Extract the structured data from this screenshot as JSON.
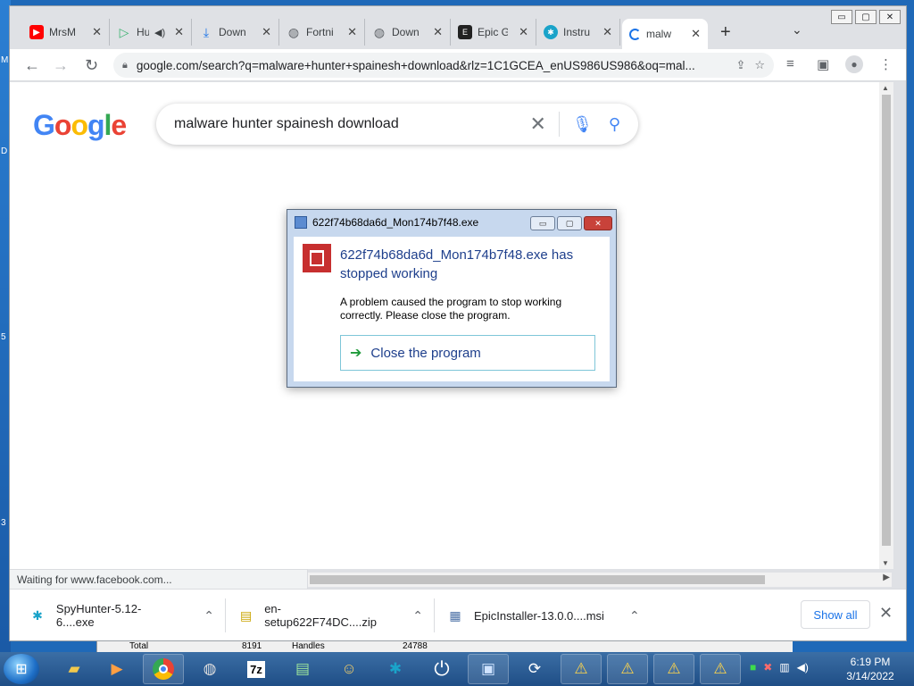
{
  "desktop": {
    "edge_labels": [
      "M",
      "D",
      "5",
      "3"
    ]
  },
  "window": {
    "tabs": [
      {
        "label": "MrsM",
        "icon": "youtube-icon",
        "color": "#ff0000"
      },
      {
        "label": "Hu",
        "icon": "play-icon",
        "color": "#3cb371",
        "audio": true
      },
      {
        "label": "Down",
        "icon": "download-icon",
        "color": "#1a73e8"
      },
      {
        "label": "Fortni",
        "icon": "globe-icon",
        "color": "#5f6368"
      },
      {
        "label": "Down",
        "icon": "globe-icon",
        "color": "#5f6368"
      },
      {
        "label": "Epic G",
        "icon": "epic-icon",
        "color": "#222222"
      },
      {
        "label": "Instru",
        "icon": "spyhunter-icon",
        "color": "#1aa3c9"
      },
      {
        "label": "malw",
        "icon": "loading-icon",
        "color": "#1a73e8",
        "active": true
      }
    ],
    "controls": {
      "minimize": "▭",
      "maximize": "▢",
      "close": "✕"
    }
  },
  "toolbar": {
    "back": "←",
    "forward": "→",
    "loading": "↻",
    "url": "google.com/search?q=malware+hunter+spainesh+download&rlz=1C1GCEA_enUS986US986&oq=mal..."
  },
  "page": {
    "logo_letters": [
      {
        "ch": "G",
        "color": "#4285f4"
      },
      {
        "ch": "o",
        "color": "#ea4335"
      },
      {
        "ch": "o",
        "color": "#fbbc05"
      },
      {
        "ch": "g",
        "color": "#4285f4"
      },
      {
        "ch": "l",
        "color": "#34a853"
      },
      {
        "ch": "e",
        "color": "#ea4335"
      }
    ],
    "search_query": "malware hunter spainesh download",
    "status": "Waiting for www.facebook.com..."
  },
  "dialog": {
    "title": "622f74b68da6d_Mon174b7f48.exe",
    "headline": "622f74b68da6d_Mon174b7f48.exe has stopped working",
    "message": "A problem caused the program to stop working correctly. Please close the program.",
    "action": "Close the program"
  },
  "downloads": {
    "items": [
      {
        "name": "SpyHunter-5.12-6....exe"
      },
      {
        "name": "en-setup622F74DC....zip"
      },
      {
        "name": "EpicInstaller-13.0.0....msi"
      }
    ],
    "show_all": "Show all"
  },
  "behind": {
    "total_label": "Total",
    "total_value": "8191",
    "handles_label": "Handles",
    "handles_value": "24788"
  },
  "taskbar": {
    "time": "6:19 PM",
    "date": "3/14/2022"
  }
}
